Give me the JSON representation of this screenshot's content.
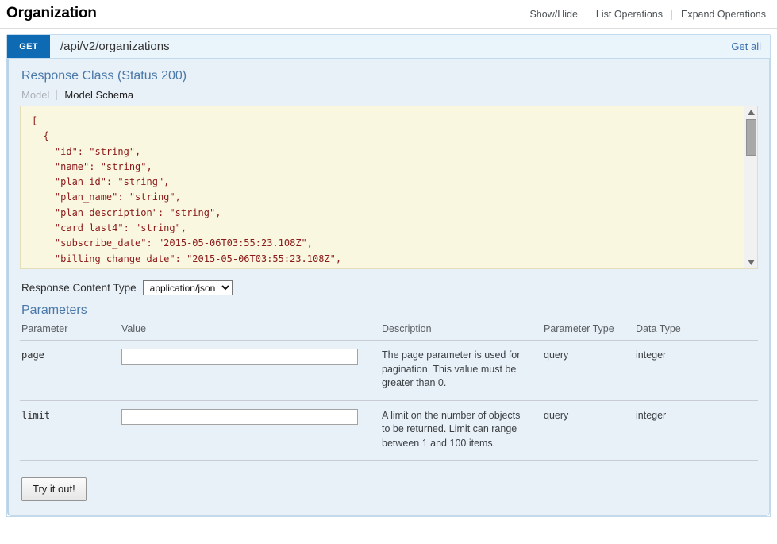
{
  "resource": {
    "title": "Organization",
    "options": [
      {
        "label": "Show/Hide"
      },
      {
        "label": "List Operations"
      },
      {
        "label": "Expand Operations"
      }
    ]
  },
  "endpoint": {
    "method": "GET",
    "path": "/api/v2/organizations",
    "summary": "Get all"
  },
  "response_class": {
    "title": "Response Class (Status 200)",
    "tabs": [
      {
        "label": "Model",
        "active": false
      },
      {
        "label": "Model Schema",
        "active": true
      }
    ],
    "schema_text": "[\n  {\n    \"id\": \"string\",\n    \"name\": \"string\",\n    \"plan_id\": \"string\",\n    \"plan_name\": \"string\",\n    \"plan_description\": \"string\",\n    \"card_last4\": \"string\",\n    \"subscribe_date\": \"2015-05-06T03:55:23.108Z\",\n    \"billing_change_date\": \"2015-05-06T03:55:23.108Z\",\n    \"billing_changed_by_user_id\": \"string\"",
    "scrollbar": {
      "up_arrow_icon": "triangle-up-icon",
      "down_arrow_icon": "triangle-down-icon"
    }
  },
  "content_type": {
    "label": "Response Content Type",
    "selected": "application/json",
    "options": [
      "application/json"
    ]
  },
  "parameters_section": {
    "title": "Parameters",
    "columns": [
      "Parameter",
      "Value",
      "Description",
      "Parameter Type",
      "Data Type"
    ],
    "rows": [
      {
        "name": "page",
        "value": "",
        "placeholder": "",
        "description": "The page parameter is used for pagination. This value must be greater than 0.",
        "parameter_type": "query",
        "data_type": "integer"
      },
      {
        "name": "limit",
        "value": "",
        "placeholder": "",
        "description": "A limit on the number of objects to be returned. Limit can range between 1 and 100 items.",
        "parameter_type": "query",
        "data_type": "integer"
      }
    ]
  },
  "submit": {
    "label": "Try it out!"
  },
  "colors": {
    "method_get": "#0f6ab4",
    "link": "#3a70b0",
    "section_heading": "#4a78a8",
    "panel_bg": "#e9f1f8",
    "schema_bg": "#faf7e0",
    "schema_text": "#8b1a1a"
  }
}
